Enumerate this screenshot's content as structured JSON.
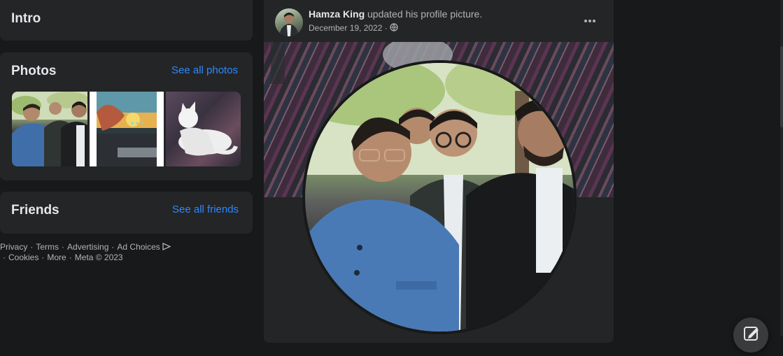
{
  "intro": {
    "title": "Intro"
  },
  "photos": {
    "title": "Photos",
    "see_all": "See all photos"
  },
  "friends": {
    "title": "Friends",
    "see_all": "See all friends"
  },
  "footer": {
    "links": [
      "Privacy",
      "Terms",
      "Advertising",
      "Ad Choices",
      "Cookies",
      "More"
    ],
    "separator": "·",
    "copyright": "Meta © 2023"
  },
  "post": {
    "author": "Hamza King",
    "action": "updated his profile picture.",
    "date": "December 19, 2022",
    "date_separator": "·",
    "audience_icon": "globe-icon",
    "more_icon": "more-horizontal-icon"
  },
  "compose": {
    "icon": "compose-edit-icon"
  },
  "colors": {
    "background": "#18191a",
    "card": "#242526",
    "text_primary": "#e4e6eb",
    "text_secondary": "#b0b3b8",
    "link": "#2d88ff"
  }
}
